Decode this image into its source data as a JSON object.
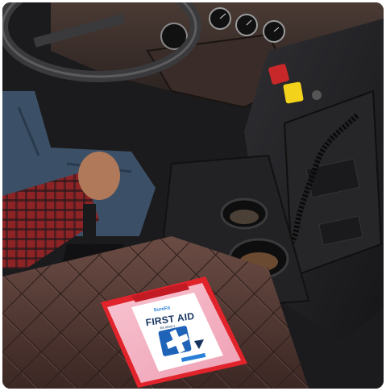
{
  "photo": {
    "kit_brand": "SureFit",
    "kit_title": "FIRST AID",
    "kit_subtitle": "BS 8599-1"
  },
  "colors": {
    "background": "#ffffff",
    "cab_dark": "#1b1b1d",
    "seat_leather": "#5a3f38",
    "kit_red": "#e1232b",
    "kit_pink": "#f6b7c6",
    "cross_blue": "#1f63b8",
    "plaid_red": "#9b2a2c",
    "denim": "#3b4f66",
    "warning_yellow": "#f2d21a",
    "button_red": "#c8282a"
  }
}
